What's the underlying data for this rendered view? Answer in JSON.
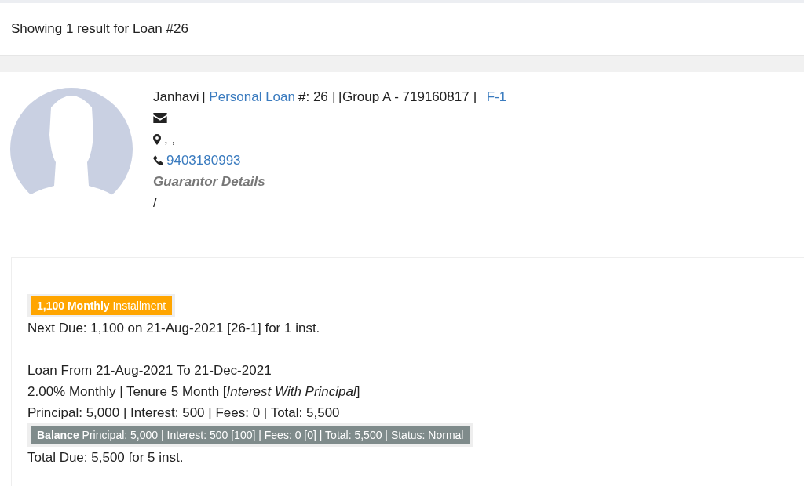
{
  "header": {
    "text": "Showing 1 result for Loan #26"
  },
  "borrower": {
    "name": "Janhavi",
    "bracket_open": "[",
    "loan_type": "Personal Loan",
    "loan_number": "#: 26 ]",
    "group": "[Group A - 719160817 ]",
    "code": "F-1",
    "address": ", ,",
    "phone": "9403180993",
    "guarantor_heading": "Guarantor Details",
    "guarantor_value": "/"
  },
  "loan": {
    "installment_badge": "**1,100 Monthly** Installment",
    "next_due": "Next Due: 1,100 on 21-Aug-2021 [26-1] for 1 inst.",
    "period": "Loan From 21-Aug-2021 To 21-Dec-2021",
    "terms": "2.00% Monthly | Tenure 5 Month [*Interest With Principal*]",
    "amounts": "Principal: 5,000 | Interest: 500 | Fees: 0 | Total: 5,500",
    "balance_badge": "**Balance** Principal: 5,000 | Interest: 500 [100] | Fees: 0 [0] | Total: 5,500 | Status: Normal",
    "total_due": "Total Due: 5,500 for 5 inst."
  }
}
